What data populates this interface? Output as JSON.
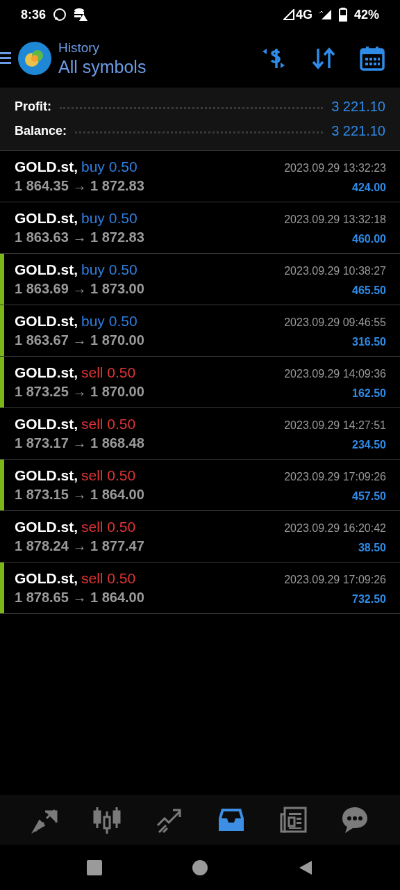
{
  "status_bar": {
    "time": "8:36",
    "network": "4G",
    "battery": "42%"
  },
  "header": {
    "subtitle": "History",
    "title": "All symbols"
  },
  "summary": [
    {
      "label": "Profit:",
      "value": "3 221.10"
    },
    {
      "label": "Balance:",
      "value": "3 221.10"
    }
  ],
  "deals": [
    {
      "symbol": "GOLD.st,",
      "kind": "buy",
      "order": "buy 0.50",
      "prices": "1 864.35 → 1 872.83",
      "time": "2023.09.29 13:32:23",
      "profit": "424.00",
      "marked": false
    },
    {
      "symbol": "GOLD.st,",
      "kind": "buy",
      "order": "buy 0.50",
      "prices": "1 863.63 → 1 872.83",
      "time": "2023.09.29 13:32:18",
      "profit": "460.00",
      "marked": false
    },
    {
      "symbol": "GOLD.st,",
      "kind": "buy",
      "order": "buy 0.50",
      "prices": "1 863.69 → 1 873.00",
      "time": "2023.09.29 10:38:27",
      "profit": "465.50",
      "marked": true
    },
    {
      "symbol": "GOLD.st,",
      "kind": "buy",
      "order": "buy 0.50",
      "prices": "1 863.67 → 1 870.00",
      "time": "2023.09.29 09:46:55",
      "profit": "316.50",
      "marked": true
    },
    {
      "symbol": "GOLD.st,",
      "kind": "sell",
      "order": "sell 0.50",
      "prices": "1 873.25 → 1 870.00",
      "time": "2023.09.29 14:09:36",
      "profit": "162.50",
      "marked": true
    },
    {
      "symbol": "GOLD.st,",
      "kind": "sell",
      "order": "sell 0.50",
      "prices": "1 873.17 → 1 868.48",
      "time": "2023.09.29 14:27:51",
      "profit": "234.50",
      "marked": false
    },
    {
      "symbol": "GOLD.st,",
      "kind": "sell",
      "order": "sell 0.50",
      "prices": "1 873.15 → 1 864.00",
      "time": "2023.09.29 17:09:26",
      "profit": "457.50",
      "marked": true
    },
    {
      "symbol": "GOLD.st,",
      "kind": "sell",
      "order": "sell 0.50",
      "prices": "1 878.24 → 1 877.47",
      "time": "2023.09.29 16:20:42",
      "profit": "38.50",
      "marked": false
    },
    {
      "symbol": "GOLD.st,",
      "kind": "sell",
      "order": "sell 0.50",
      "prices": "1 878.65 → 1 864.00",
      "time": "2023.09.29 17:09:26",
      "profit": "732.50",
      "marked": true
    }
  ],
  "bottom_nav": [
    {
      "kind": "trade",
      "selected": false
    },
    {
      "kind": "quotes",
      "selected": false
    },
    {
      "kind": "chart",
      "selected": false
    },
    {
      "kind": "history",
      "selected": true
    },
    {
      "kind": "news",
      "selected": false
    },
    {
      "kind": "chat",
      "selected": false
    }
  ]
}
